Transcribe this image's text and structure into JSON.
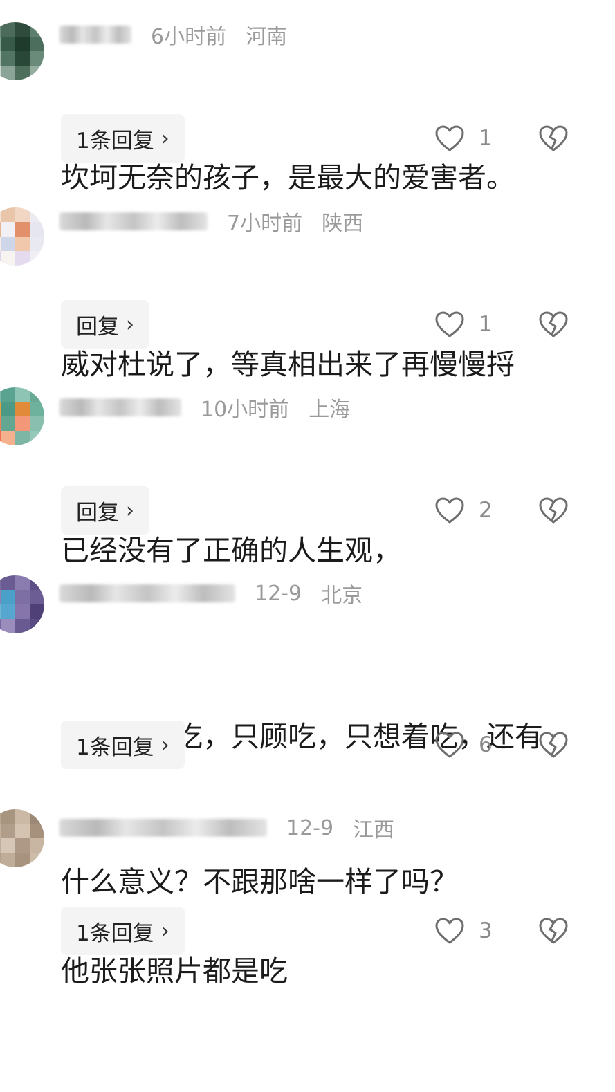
{
  "comments": [
    {
      "time": "6小时前",
      "location": "河南",
      "lines": [
        "坎坷无奈的孩子，是最大的爱害者。"
      ],
      "reply_label": "1条回复",
      "like_count": "1",
      "avatar_colors": [
        "#6c8f7a",
        "#4d6b5a",
        "#2f4b3b",
        "#5f7f6e",
        "#87a594",
        "#385a48",
        "#1e3b2c",
        "#4b6f5c",
        "#a5bdb0",
        "#527563",
        "#2a4838",
        "#6a8b79",
        "#ced9d3",
        "#8aa597",
        "#4f6f5d",
        "#93ad9f"
      ]
    },
    {
      "time": "7小时前",
      "location": "陕西",
      "lines": [
        "威对杜说了，等真相出来了再慢慢捋"
      ],
      "reply_label": "回复",
      "like_count": "1",
      "avatar_colors": [
        "#f3e2d6",
        "#e9c6a9",
        "#f0d6c3",
        "#ecebf2",
        "#e7b491",
        "#f1f0f4",
        "#e28f6b",
        "#e5e6ef",
        "#f5ece6",
        "#cfd6ea",
        "#f2c8ad",
        "#e9eaf1",
        "#ddd3ec",
        "#f6f3f0",
        "#e4dbee",
        "#f0eef4"
      ]
    },
    {
      "time": "10小时前",
      "location": "上海",
      "lines": [
        "已经没有了正确的人生观，"
      ],
      "reply_label": "回复",
      "like_count": "2",
      "avatar_colors": [
        "#7fb8a7",
        "#5aa391",
        "#8dc4b3",
        "#6aa996",
        "#e9a03b",
        "#4c9a86",
        "#e08a3a",
        "#6eb19d",
        "#f07f5a",
        "#63a692",
        "#f29778",
        "#88bfae",
        "#ef6f4f",
        "#f5b08e",
        "#7eb6a5",
        "#95c8b8"
      ]
    },
    {
      "time": "12-9",
      "location": "北京",
      "lines": [
        "人生只认吃，只顾吃，只想着吃，还有",
        "什么意义？不跟那啥一样了吗？"
      ],
      "reply_label": "1条回复",
      "like_count": "6",
      "avatar_colors": [
        "#7a6aa0",
        "#6b5b93",
        "#8b7cb0",
        "#5e4f86",
        "#9181b3",
        "#4aa0c9",
        "#7d6ea4",
        "#6c5d95",
        "#6fb5d6",
        "#56a7cf",
        "#8575ab",
        "#4f4077",
        "#7567a0",
        "#9b8dbb",
        "#6a5a92",
        "#5a4b83"
      ]
    },
    {
      "time": "12-9",
      "location": "江西",
      "lines": [
        "他张张照片都是吃"
      ],
      "reply_label": "1条回复",
      "like_count": "3",
      "avatar_colors": [
        "#b8a592",
        "#a89580",
        "#cbb9a6",
        "#9c8874",
        "#c3b09c",
        "#b19e8a",
        "#d4c3b1",
        "#a6917c",
        "#bfae9b",
        "#d6c6b5",
        "#ad9985",
        "#c8b6a3",
        "#b49f8b",
        "#c0ad99",
        "#a8937e",
        "#cdbcaa"
      ]
    }
  ],
  "colors": {
    "meta_text": "#9a9a9a",
    "content_text": "#1b1b1b",
    "reply_bg": "#f4f4f4",
    "icon_stroke": "#6e6e6e"
  },
  "icons": {
    "like": "heart-outline-icon",
    "dislike": "broken-heart-icon",
    "chevron": "chevron-right-icon"
  }
}
